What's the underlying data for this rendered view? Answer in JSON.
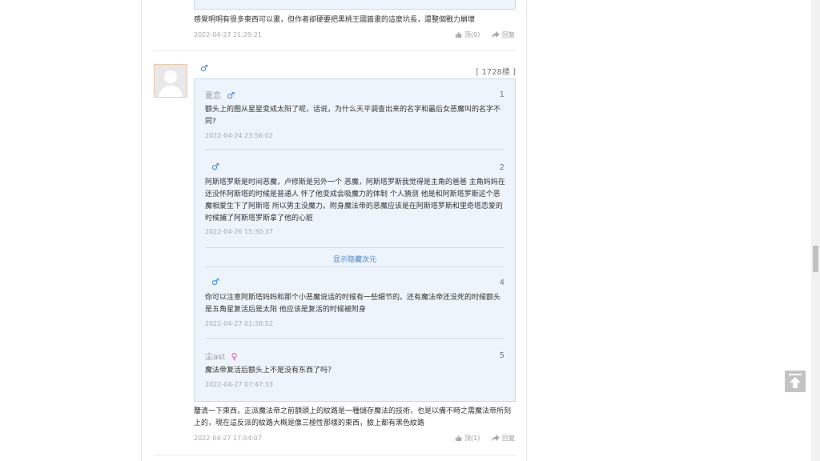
{
  "prev_comment": {
    "text": "感覺明明有很多東西可以畫，但作者卻硬要把黑桃王國篇畫的這麼坑長，還整個戰力崩壞",
    "date": "2022-04-27 21:29:21",
    "like_label": "顶(0)",
    "reply_label": "回复"
  },
  "comment": {
    "floor": "[ 1728楼 ]",
    "gender_icon": "male-icon",
    "replies": [
      {
        "user": "夏恋",
        "gender": "male",
        "index": "1",
        "text": "额头上的图从星星变成太阳了呢，话说，为什么天平调查出来的名字和最后女恶魔叫的名字不同?",
        "date": "2022-04-24 23:56:02"
      },
      {
        "user": "",
        "gender": "male",
        "index": "2",
        "text": "阿斯塔罗斯是时间恶魔，卢修斯是另外一个 恶魔，阿斯塔罗斯我觉得是主角的爸爸 主角妈妈在还没怀阿斯塔的时候是普通人 怀了他变成会吸魔力的体制 个人猜测 他是和阿斯塔罗斯这个恶魔相爱生下了阿斯塔 所以男主没魔力。附身魔法帝的恶魔应该是在阿斯塔罗斯和里奇塔恋爱的时候捕了阿斯塔罗斯拿了他的心脏",
        "date": "2022-04-26 15:30:37"
      },
      {
        "user": "",
        "gender": "male",
        "index": "4",
        "text": "你可以注意阿斯塔妈妈和那个小恶魔说话的时候有一些细节的。还有魔法帝还没死的时候额头是五角星复活后是太阳 他应该是复活的时候被附身",
        "date": "2022-04-27 01:38:52"
      },
      {
        "user": "尘ast",
        "gender": "female",
        "index": "5",
        "text": "魔法帝复活后额头上不是没有东西了吗？",
        "date": "2022-04-27 07:47:33"
      }
    ],
    "show_hidden": "显示隐藏次元",
    "main_text": "釐清一下東西，正派魔法帝之前額頭上的紋路是一種儲存魔法的技術，也是以備不時之需魔法帝所刻上的，現在這反派的紋路大概是像三極性那樣的東西，臉上都有黑色紋路",
    "main_date": "2022-04-27 17:54:07",
    "like_label": "顶(1)",
    "reply_label": "回复"
  }
}
